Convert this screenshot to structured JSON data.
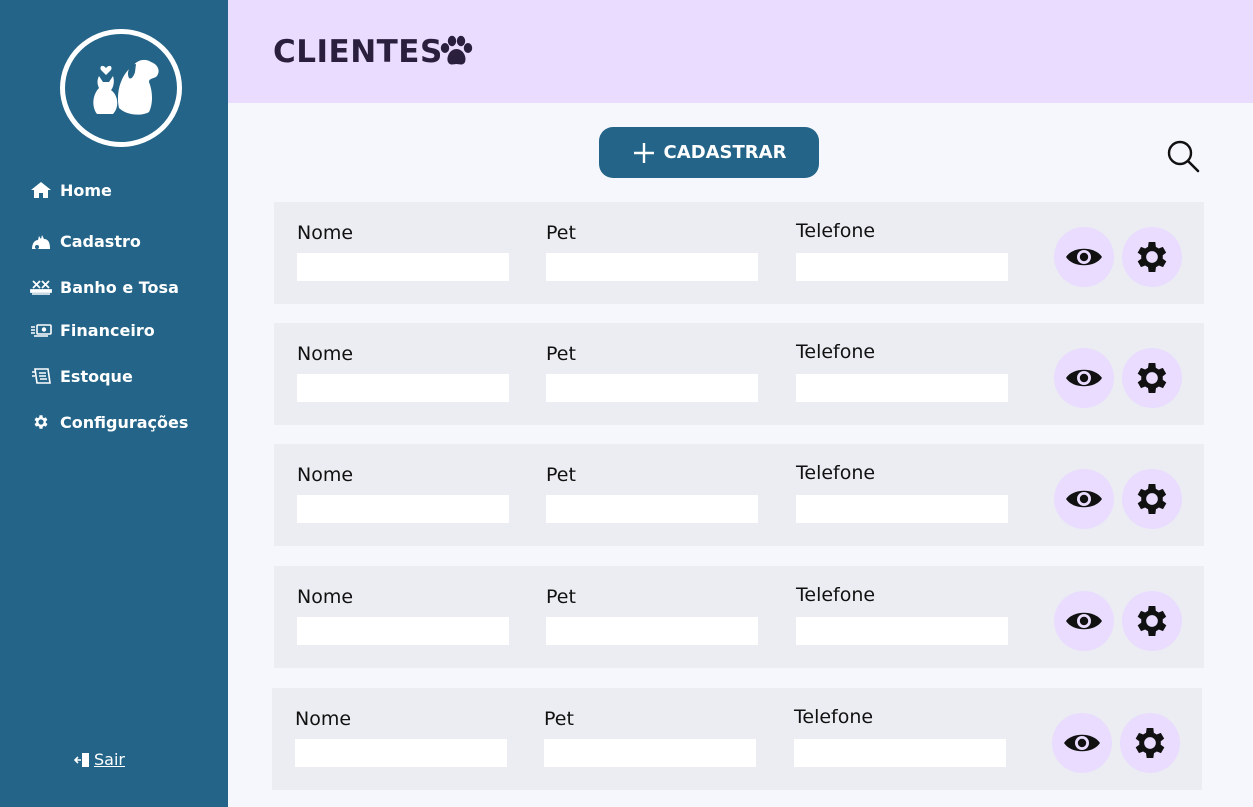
{
  "sidebar": {
    "logo_icon": "cat-and-dog-logo",
    "nav": [
      {
        "label": "Home",
        "icon": "house-icon"
      },
      {
        "label": "Cadastro",
        "icon": "pets-icon"
      },
      {
        "label": "Banho e Tosa",
        "icon": "grooming-icon"
      },
      {
        "label": "Financeiro",
        "icon": "money-icon"
      },
      {
        "label": "Estoque",
        "icon": "box-icon"
      },
      {
        "label": "Configurações",
        "icon": "gear-icon"
      }
    ],
    "logout_label": "Sair",
    "logout_icon": "logout-icon"
  },
  "header": {
    "title": "CLIENTES",
    "icon": "paw-icon"
  },
  "toolbar": {
    "add_label": "CADASTRAR",
    "add_icon": "plus-icon",
    "search_icon": "search-icon"
  },
  "clients": [
    {
      "name_label": "Nome",
      "pet_label": "Pet",
      "phone_label": "Telefone",
      "name_value": "",
      "pet_value": "",
      "phone_value": ""
    },
    {
      "name_label": "Nome",
      "pet_label": "Pet",
      "phone_label": "Telefone",
      "name_value": "",
      "pet_value": "",
      "phone_value": ""
    },
    {
      "name_label": "Nome",
      "pet_label": "Pet",
      "phone_label": "Telefone",
      "name_value": "",
      "pet_value": "",
      "phone_value": ""
    },
    {
      "name_label": "Nome",
      "pet_label": "Pet",
      "phone_label": "Telefone",
      "name_value": "",
      "pet_value": "",
      "phone_value": ""
    },
    {
      "name_label": "Nome",
      "pet_label": "Pet",
      "phone_label": "Telefone",
      "name_value": "",
      "pet_value": "",
      "phone_value": ""
    }
  ],
  "row_actions": {
    "view_icon": "eye-icon",
    "settings_icon": "gear-icon"
  },
  "colors": {
    "sidebar": "#236488",
    "header": "#e9dcff",
    "row_bg": "#ebedf2",
    "action_bg": "#e9dcff",
    "primary": "#236488"
  }
}
